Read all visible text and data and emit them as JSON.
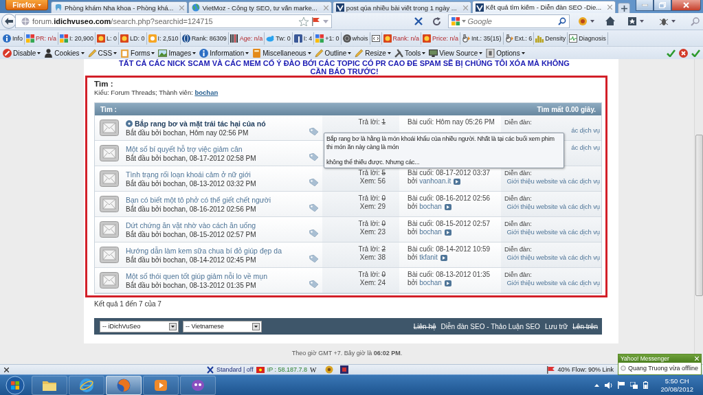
{
  "browser": {
    "menu_button": "Firefox",
    "tabs": [
      {
        "title": "Phòng khám Nha khoa - Phòng khá...",
        "selected": false
      },
      {
        "title": "VietMoz - Công ty SEO, tư vấn marke...",
        "selected": false
      },
      {
        "title": "post qúa nhiều bài viết trong 1 ngày ...",
        "selected": false
      },
      {
        "title": "Kết quả tìm kiếm - Diễn đàn SEO -Die...",
        "selected": true
      }
    ],
    "address": "forum.**idichvuseo.com**/search.php?searchid=124715",
    "search_placeholder": "Google"
  },
  "seo_toolbar": [
    {
      "kind": "info",
      "label": "Info",
      "alert": false
    },
    {
      "kind": "tiles",
      "label": "PR: n/a",
      "alert": true
    },
    {
      "kind": "tiles",
      "label": "I: 20,900",
      "alert": false
    },
    {
      "kind": "sun",
      "label": "L: 0",
      "alert": false
    },
    {
      "kind": "sun",
      "label": "LD: 0",
      "alert": false
    },
    {
      "kind": "ring",
      "label": "I: 2,510",
      "alert": false
    },
    {
      "kind": "globe",
      "label": "Rank: 86309",
      "alert": false
    },
    {
      "kind": "bars",
      "label": "Age: n/a",
      "alert": true
    },
    {
      "kind": "bird",
      "label": "Tw: 0",
      "alert": false
    },
    {
      "kind": "square",
      "label": "I: 4",
      "alert": false
    },
    {
      "kind": "tiles",
      "label": "+1: 0",
      "alert": false
    },
    {
      "kind": "disc",
      "label": "whois",
      "alert": false
    },
    {
      "kind": "code"
    },
    {
      "kind": "sun",
      "label": "Rank: n/a",
      "alert": true
    },
    {
      "kind": "sun",
      "label": "Price: n/a",
      "alert": true
    },
    {
      "kind": "hand",
      "label": "Int.: 35(15)",
      "alert": false
    },
    {
      "kind": "hand",
      "label": "Ext.: 6",
      "alert": false
    },
    {
      "kind": "chart",
      "label": "Density",
      "alert": false
    },
    {
      "kind": "pulse",
      "label": "Diagnosis",
      "alert": false
    }
  ],
  "dev_toolbar": [
    {
      "kind": "noentry",
      "label": "Disable"
    },
    {
      "kind": "person",
      "label": "Cookies"
    },
    {
      "kind": "pencil",
      "label": "CSS"
    },
    {
      "kind": "clipboard",
      "label": "Forms"
    },
    {
      "kind": "image",
      "label": "Images"
    },
    {
      "kind": "info",
      "label": "Information"
    },
    {
      "kind": "book",
      "label": "Miscellaneous"
    },
    {
      "kind": "pencil",
      "label": "Outline"
    },
    {
      "kind": "pencil",
      "label": "Resize"
    },
    {
      "kind": "wrench",
      "label": "Tools"
    },
    {
      "kind": "monitor",
      "label": "View Source"
    },
    {
      "kind": "lock",
      "label": "Options"
    }
  ],
  "page": {
    "notice_lines": [
      "TẤT CẢ CÁC NICK SCAM VÀ CÁC MEM CỐ Ý ĐÀO BỚI CÁC TOPIC CÓ PR CAO ĐỂ SPAM SẼ BỊ CHÚNG TÔI XÓA MÀ KHÔNG",
      "CẦN BÁO TRƯỚC!"
    ],
    "search_title": "Tìm :",
    "criteria": "Kiểu: Forum Threads; Thành viên:",
    "member": "bochan",
    "header_left": "Tìm :",
    "header_right": "Tìm mất 0.00 giây.",
    "threads": [
      {
        "title": "Bắp rang bơ và mặt trái tác hại của nó",
        "unread": true,
        "starter": "Bắt đầu bởi bochan, Hôm nay 02:56 PM",
        "replies_label": "Trả lời:",
        "replies": "1",
        "struck": true,
        "last_post": "Bài cuối: Hôm nay 05:26 PM",
        "forum_label": "Diễn đàn:",
        "forum": "ác dịch vụ"
      },
      {
        "title": "Một số bí quyết hỗ trợ việc giảm cân",
        "unread": false,
        "starter": "Bắt đầu bởi bochan, 08-17-2012 02:58 PM",
        "forum": "ác dịch vụ"
      },
      {
        "title": "Tình trạng rối loạn khoái cảm ở nữ giới",
        "unread": false,
        "starter": "Bắt đầu bởi bochan, 08-13-2012 03:32 PM",
        "replies_label": "Trả lời:",
        "replies": "5",
        "struck": true,
        "views": "Xem: 56",
        "last_post": "Bài cuối: 08-17-2012 03:37",
        "by_label": "bởi",
        "by": "vanhoan.it",
        "forum_label": "Diễn đàn:",
        "forum": "Giới thiệu website và các dịch vụ"
      },
      {
        "title": "Bạn có biết một tô phở có thể giết chết người",
        "unread": false,
        "starter": "Bắt đầu bởi bochan, 08-16-2012 02:56 PM",
        "replies_label": "Trả lời:",
        "replies": "0",
        "struck": true,
        "views": "Xem: 29",
        "last_post": "Bài cuối: 08-16-2012 02:56",
        "by_label": "bởi",
        "by": "bochan",
        "forum_label": "Diễn đàn:",
        "forum": "Giới thiệu website và các dịch vụ"
      },
      {
        "title": "Dứt chứng ăn vặt nhờ vào cách ăn uống",
        "unread": false,
        "starter": "Bắt đầu bởi bochan, 08-15-2012 02:57 PM",
        "replies_label": "Trả lời:",
        "replies": "0",
        "struck": true,
        "views": "Xem: 23",
        "last_post": "Bài cuối: 08-15-2012 02:57",
        "by_label": "bởi",
        "by": "bochan",
        "forum_label": "Diễn đàn:",
        "forum": "Giới thiệu website và các dịch vụ"
      },
      {
        "title": "Hướng dẫn làm kem sữa chua bí đỏ giúp đẹp da",
        "unread": false,
        "starter": "Bắt đầu bởi bochan, 08-14-2012 02:45 PM",
        "replies_label": "Trả lời:",
        "replies": "2",
        "struck": true,
        "views": "Xem: 38",
        "last_post": "Bài cuối: 08-14-2012 10:59",
        "by_label": "bởi",
        "by": "tkfanit",
        "forum_label": "Diễn đàn:",
        "forum": "Giới thiệu website và các dịch vụ"
      },
      {
        "title": "Một số thói quen tốt giúp giảm nỗi lo về mụn",
        "unread": false,
        "starter": "Bắt đầu bởi bochan, 08-13-2012 01:35 PM",
        "replies_label": "Trả lời:",
        "replies": "0",
        "struck": true,
        "views": "Xem: 24",
        "last_post": "Bài cuối: 08-13-2012 01:35",
        "by_label": "bởi",
        "by": "bochan",
        "forum_label": "Diễn đàn:",
        "forum": "Giới thiệu website và các dịch vụ"
      }
    ],
    "tooltip": [
      "Bắp rang bơ là hằng là món khoái khẩu của nhiều người. Nhất là tại các buổi xem phim thi món ăn này càng là món",
      "không thể thiếu được. Nhưng các..."
    ],
    "result_count": "Kết quả 1 đến 7 của 7",
    "selects": [
      "-- iDichVuSeo",
      "-- Vietnamese"
    ],
    "footer_links": [
      {
        "label": "Liên hệ",
        "struck": true
      },
      {
        "label": "Diễn đàn SEO - Thảo Luận SEO",
        "struck": false
      },
      {
        "label": "Lưu trữ",
        "struck": false
      },
      {
        "label": "Lên trên",
        "struck": true
      }
    ],
    "time_note": "Theo giờ GMT +7. Bây giờ là **06:02 PM**."
  },
  "addon_bar": {
    "status_text": "Standard | off",
    "ip": "IP : 58.187.7.8",
    "wiki_glyph": "W",
    "flow": "40% Flow: 90% Link"
  },
  "messenger_popup": {
    "title": "Yahoo! Messenger",
    "message": "Quang Truong vừa offline"
  },
  "taskbar": {
    "apps": [
      {
        "kind": "folder",
        "selected": false
      },
      {
        "kind": "ie",
        "selected": false
      },
      {
        "kind": "firefox",
        "selected": true
      },
      {
        "kind": "media",
        "selected": false
      },
      {
        "kind": "messenger",
        "selected": false
      }
    ],
    "time": "5:50 CH",
    "date": "20/08/2012"
  }
}
